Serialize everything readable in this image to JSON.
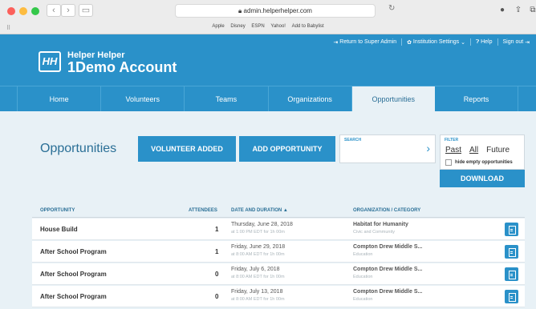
{
  "browser": {
    "url": "admin.helperhelper.com",
    "favorites": [
      "Apple",
      "Disney",
      "ESPN",
      "Yahoo!",
      "Add to Babylist"
    ]
  },
  "header": {
    "logo_text": "HH",
    "brand": "Helper Helper",
    "account": "1Demo Account",
    "links": {
      "return": "Return to Super Admin",
      "institution": "Institution Settings",
      "help": "Help",
      "signout": "Sign out"
    }
  },
  "nav": [
    "Home",
    "Volunteers",
    "Teams",
    "Organizations",
    "Opportunities",
    "Reports"
  ],
  "active_nav": "Opportunities",
  "page": {
    "title": "Opportunities",
    "volunteer_added": "VOLUNTEER ADDED",
    "add_opportunity": "ADD OPPORTUNITY",
    "search_label": "SEARCH",
    "search_value": "",
    "filter_label": "FILTER",
    "filter_past": "Past",
    "filter_all": "All",
    "filter_future": "Future",
    "hide_empty": "hide empty opportunities",
    "download": "DOWNLOAD"
  },
  "table": {
    "headers": {
      "opportunity": "OPPORTUNITY",
      "attendees": "ATTENDEES",
      "date": "DATE AND DURATION ▲",
      "org": "ORGANIZATION / CATEGORY"
    },
    "rows": [
      {
        "title": "House Build",
        "attendees": "1",
        "date": "Thursday, June 28, 2018",
        "duration": "at 1:00 PM EDT for 1h 00m",
        "org": "Habitat for Humanity",
        "category": "Civic and Community"
      },
      {
        "title": "After School Program",
        "attendees": "1",
        "date": "Friday, June 29, 2018",
        "duration": "at 8:00 AM EDT for 1h 00m",
        "org": "Compton Drew Middle S...",
        "category": "Education"
      },
      {
        "title": "After School Program",
        "attendees": "0",
        "date": "Friday, July 6, 2018",
        "duration": "at 8:00 AM EDT for 1h 00m",
        "org": "Compton Drew Middle S...",
        "category": "Education"
      },
      {
        "title": "After School Program",
        "attendees": "0",
        "date": "Friday, July 13, 2018",
        "duration": "at 8:00 AM EDT for 1h 00m",
        "org": "Compton Drew Middle S...",
        "category": "Education"
      }
    ]
  }
}
